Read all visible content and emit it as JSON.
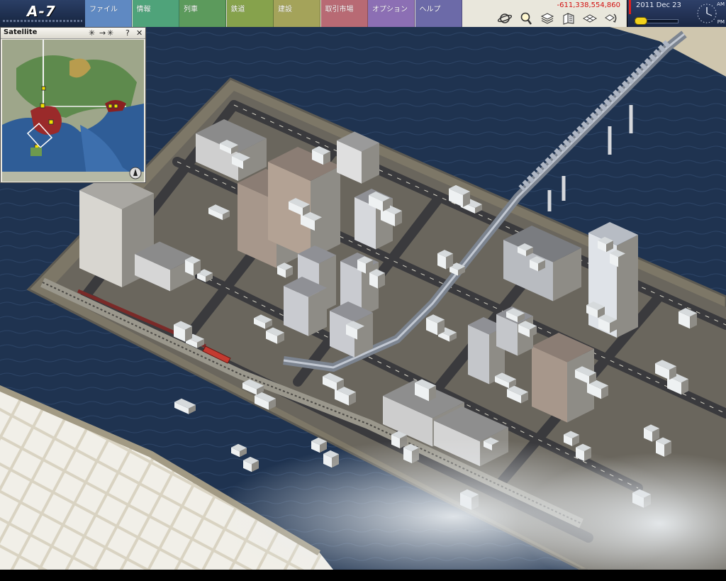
{
  "logo": {
    "text": "A-7"
  },
  "menu": [
    {
      "label": "ファイル",
      "color": "#5f89c2"
    },
    {
      "label": "情報",
      "color": "#4fa37a"
    },
    {
      "label": "列車",
      "color": "#5c9a5c"
    },
    {
      "label": "鉄道",
      "color": "#86a24c"
    },
    {
      "label": "建設",
      "color": "#a4a35a"
    },
    {
      "label": "取引市場",
      "color": "#b86a74"
    },
    {
      "label": "オプション",
      "color": "#8c6fb4"
    },
    {
      "label": "ヘルプ",
      "color": "#6c6aa8"
    }
  ],
  "status": {
    "money": "-611,338,554,860",
    "date": "2011 Dec 23",
    "am": "AM",
    "pm": "PM"
  },
  "toolbar_icons": [
    "planet-view-icon",
    "magnifier-icon",
    "layers-icon",
    "building-view-icon",
    "grid-view-icon",
    "rotate-view-icon"
  ],
  "satellite": {
    "title": "Satellite",
    "buttons": {
      "zoom_out": "✳",
      "arrow": "→",
      "zoom_in": "✳",
      "help": "?",
      "close": "✕"
    }
  },
  "colors": {
    "sea": "#1f3350",
    "land": "#5f5a4d",
    "road": "#3a3a3d",
    "money_negative": "#d31010",
    "accent_red": "#e02020"
  }
}
